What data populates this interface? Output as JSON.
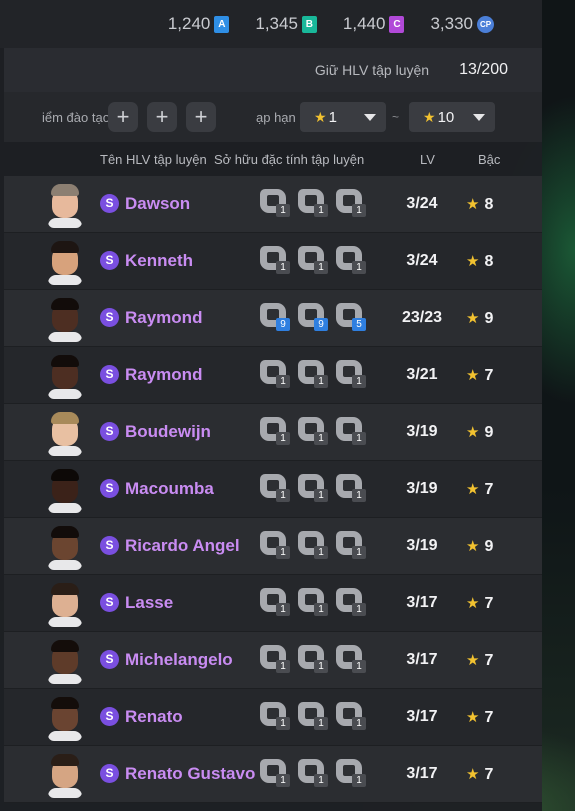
{
  "currency": [
    {
      "value": "1,240",
      "badge": "A",
      "kind": "a"
    },
    {
      "value": "1,345",
      "badge": "B",
      "kind": "b"
    },
    {
      "value": "1,440",
      "badge": "C",
      "kind": "c"
    },
    {
      "value": "3,330",
      "badge": "CP",
      "kind": "cp"
    }
  ],
  "header": {
    "keep_label": "Giữ HLV tập luyện",
    "keep_count": "13/200"
  },
  "filter": {
    "training_label": "iểm đào tạo",
    "rank_label": "ạp hạng",
    "rank_min": "1",
    "rank_max": "10",
    "separator": "~"
  },
  "columns": {
    "name": "Tên HLV tập luyện",
    "traits": "Sở hữu đặc tính tập luyện",
    "level": "LV",
    "grade": "Bậc"
  },
  "coaches": [
    {
      "name": "Dawson",
      "lv": "3/24",
      "grade": "8",
      "traits": [
        "1",
        "1",
        "1"
      ],
      "skin": "#e7b99c",
      "hair": "#8c7f72",
      "shirt": "#e8e8ea",
      "trait_hi": false
    },
    {
      "name": "Kenneth",
      "lv": "3/24",
      "grade": "8",
      "traits": [
        "1",
        "1",
        "1"
      ],
      "skin": "#d7a27c",
      "hair": "#1d1512",
      "shirt": "#e8e8ea",
      "trait_hi": false
    },
    {
      "name": "Raymond",
      "lv": "23/23",
      "grade": "9",
      "traits": [
        "9",
        "9",
        "5"
      ],
      "skin": "#4d2e22",
      "hair": "#120c0a",
      "shirt": "#e8e8ea",
      "trait_hi": true
    },
    {
      "name": "Raymond",
      "lv": "3/21",
      "grade": "7",
      "traits": [
        "1",
        "1",
        "1"
      ],
      "skin": "#4d2e22",
      "hair": "#120c0a",
      "shirt": "#e8e8ea",
      "trait_hi": false
    },
    {
      "name": "Boudewijn",
      "lv": "3/19",
      "grade": "9",
      "traits": [
        "1",
        "1",
        "1"
      ],
      "skin": "#e8c0a2",
      "hair": "#a88a5a",
      "shirt": "#e8e8ea",
      "trait_hi": false
    },
    {
      "name": "Macoumba",
      "lv": "3/19",
      "grade": "7",
      "traits": [
        "1",
        "1",
        "1"
      ],
      "skin": "#3b2219",
      "hair": "#0d0907",
      "shirt": "#e8e8ea",
      "trait_hi": false
    },
    {
      "name": "Ricardo Angel",
      "lv": "3/19",
      "grade": "9",
      "traits": [
        "1",
        "1",
        "1"
      ],
      "skin": "#6b4530",
      "hair": "#120c0a",
      "shirt": "#e8e8ea",
      "trait_hi": false
    },
    {
      "name": "Lasse",
      "lv": "3/17",
      "grade": "7",
      "traits": [
        "1",
        "1",
        "1"
      ],
      "skin": "#ddb092",
      "hair": "#2a1e17",
      "shirt": "#e8e8ea",
      "trait_hi": false
    },
    {
      "name": "Michelangelo",
      "lv": "3/17",
      "grade": "7",
      "traits": [
        "1",
        "1",
        "1"
      ],
      "skin": "#5e3b29",
      "hair": "#140d0a",
      "shirt": "#e8e8ea",
      "trait_hi": false
    },
    {
      "name": "Renato",
      "lv": "3/17",
      "grade": "7",
      "traits": [
        "1",
        "1",
        "1"
      ],
      "skin": "#6a4431",
      "hair": "#140d0a",
      "shirt": "#e8e8ea",
      "trait_hi": false
    },
    {
      "name": "Renato Gustavo",
      "lv": "3/17",
      "grade": "7",
      "traits": [
        "1",
        "1",
        "1"
      ],
      "skin": "#d5a583",
      "hair": "#2a1e17",
      "shirt": "#e8e8ea",
      "trait_hi": false
    }
  ],
  "colors": {
    "accent_name": "#c98cf2",
    "star": "#f2c230",
    "badge_s": "#7a4fe0"
  }
}
